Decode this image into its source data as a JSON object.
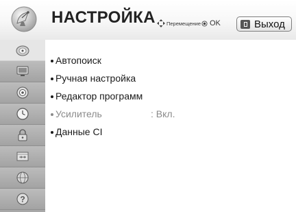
{
  "header": {
    "title": "НАСТРОЙКА",
    "nav_hint": "Перемещение",
    "ok_label": "OK",
    "exit_label": "Выход"
  },
  "sidebar": {
    "items": [
      {
        "icon": "satellite-dish-icon",
        "active": true
      },
      {
        "icon": "tv-picture-icon",
        "active": false
      },
      {
        "icon": "speaker-icon",
        "active": false
      },
      {
        "icon": "clock-icon",
        "active": false
      },
      {
        "icon": "lock-icon",
        "active": false
      },
      {
        "icon": "options-icon",
        "active": false
      },
      {
        "icon": "network-globe-icon",
        "active": false
      },
      {
        "icon": "help-icon",
        "active": false
      }
    ]
  },
  "menu": {
    "items": [
      {
        "label": "Автопоиск",
        "value": "",
        "enabled": true
      },
      {
        "label": "Ручная настройка",
        "value": "",
        "enabled": true
      },
      {
        "label": "Редактор программ",
        "value": "",
        "enabled": true
      },
      {
        "label": "Усилитель",
        "value": ": Вкл.",
        "enabled": false
      },
      {
        "label": "Данные CI",
        "value": "",
        "enabled": true
      }
    ]
  },
  "colors": {
    "sidebar_bg": "#a8a8a8",
    "sidebar_active": "#e6e6e6",
    "text": "#1a1a1a",
    "disabled_text": "#8a8a8a"
  }
}
